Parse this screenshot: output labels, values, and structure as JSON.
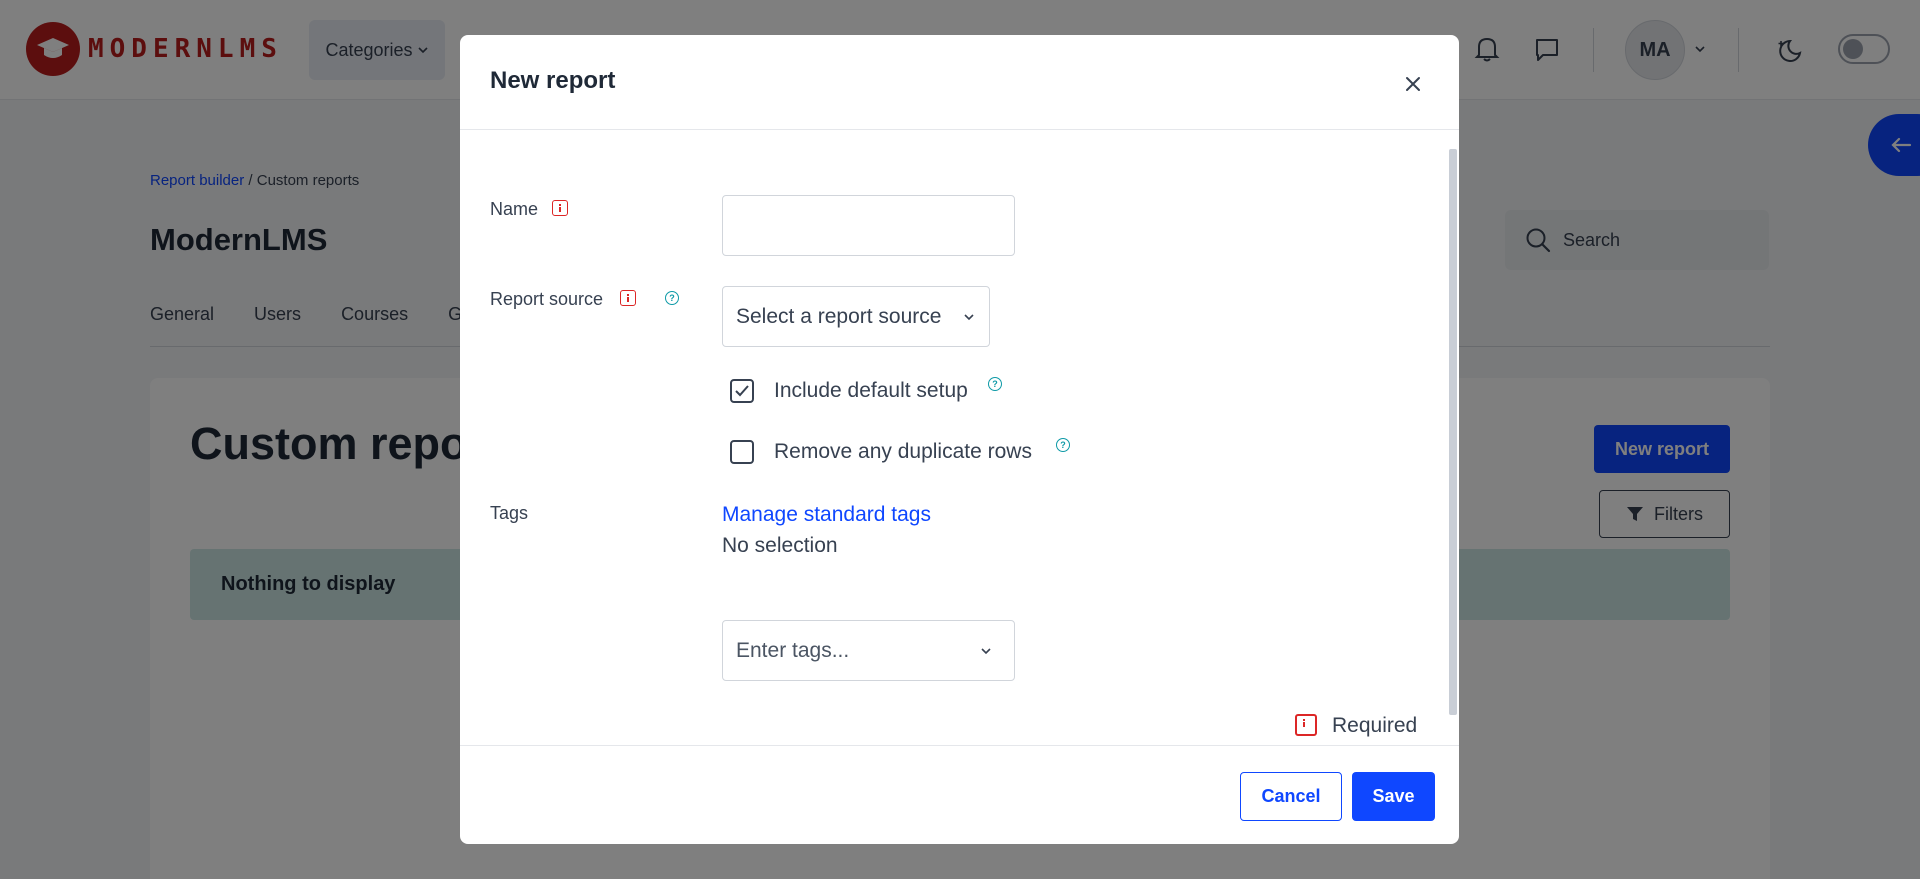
{
  "header": {
    "logo_text": "MODERNLMS",
    "nav_categories": "Categories",
    "avatar_initials": "MA"
  },
  "page": {
    "breadcrumb": {
      "link": "Report builder",
      "separator": "/",
      "current": "Custom reports"
    },
    "site_title": "ModernLMS",
    "search_placeholder": "Search",
    "tabs": [
      "General",
      "Users",
      "Courses",
      "G"
    ],
    "heading": "Custom repor",
    "new_report_button": "New report",
    "filters_button": "Filters",
    "empty_message": "Nothing to display"
  },
  "modal": {
    "title": "New report",
    "fields": {
      "name_label": "Name",
      "name_value": "",
      "source_label": "Report source",
      "source_selected": "Select a report source",
      "include_default_label": "Include default setup",
      "include_default_checked": true,
      "remove_duplicates_label": "Remove any duplicate rows",
      "remove_duplicates_checked": false,
      "tags_label": "Tags",
      "manage_tags_link": "Manage standard tags",
      "tags_selection": "No selection",
      "tags_placeholder": "Enter tags..."
    },
    "required_label": "Required",
    "cancel_label": "Cancel",
    "save_label": "Save"
  },
  "colors": {
    "primary": "#0f47ff",
    "brand": "#b91c1c",
    "required": "#dc2626",
    "help": "#0e9aa7",
    "empty_notice": "#cde7e5"
  }
}
